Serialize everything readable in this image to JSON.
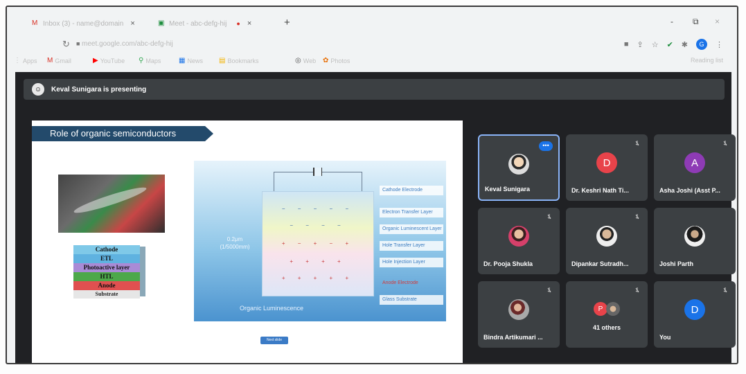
{
  "browser": {
    "tabs": [
      {
        "icon": "gmail-icon",
        "label": "Inbox (3) - name@domain"
      },
      {
        "icon": "meet-icon",
        "label": "Meet - abc-defg-hij"
      }
    ],
    "new_tab": "+",
    "window_controls": [
      "-",
      "⧉",
      "×"
    ],
    "url": "meet.google.com/abc-defg-hij",
    "profile_initial": "G",
    "bookmarks": [
      {
        "icon": "apps-icon",
        "label": "Apps"
      },
      {
        "icon": "gmail-icon",
        "label": "Gmail"
      },
      {
        "icon": "youtube-icon",
        "label": "YouTube"
      },
      {
        "icon": "maps-icon",
        "label": "Maps"
      },
      {
        "icon": "news-icon",
        "label": "News"
      },
      {
        "icon": "folder-icon",
        "label": "Bookmarks"
      },
      {
        "icon": "globe-icon",
        "label": "Web"
      },
      {
        "icon": "photos-icon",
        "label": "Photos"
      }
    ],
    "reading_list": "Reading list"
  },
  "meet": {
    "presenting_banner": "Keval Sunigara is presenting",
    "slide": {
      "title": "Role of organic semiconductors",
      "device_layers": [
        "Cathode",
        "ETL",
        "Photoactive layer",
        "HTL",
        "Anode"
      ],
      "substrate_label": "Substrate",
      "diagram_labels": [
        "Cathode Electrode",
        "Electron Transfer Layer",
        "Organic Luminescent Layer",
        "Hole Transfer Layer",
        "Hole Injection Layer",
        "Anode Electrode",
        "Glass Substrate"
      ],
      "thickness_label": "0.2μm (1/5000mm)",
      "diagram_caption": "Organic Luminescence",
      "bottom_button": "Next slide"
    },
    "participants": [
      {
        "name": "Keval Sunigara",
        "avatar": "photo",
        "active": true
      },
      {
        "name": "Dr. Keshri Nath Ti...",
        "avatar": "initial",
        "initial": "D",
        "color": "#e8434a"
      },
      {
        "name": "Asha Joshi (Asst P...",
        "avatar": "initial",
        "initial": "A",
        "color": "#8e3bb5"
      },
      {
        "name": "Dr. Pooja Shukla",
        "avatar": "photo"
      },
      {
        "name": "Dipankar Sutradh...",
        "avatar": "photo"
      },
      {
        "name": "Joshi Parth",
        "avatar": "photo"
      },
      {
        "name": "Bindra Artikumari ...",
        "avatar": "photo"
      },
      {
        "name": "41 others",
        "avatar": "group"
      },
      {
        "name": "You",
        "avatar": "initial",
        "initial": "D",
        "color": "#1a73e8"
      }
    ],
    "more_options": "•••",
    "colors": {
      "meet_bg": "#202124",
      "tile_bg": "#3c4043",
      "active_border": "#8ab4f8",
      "slide_title_bg": "#234a6b"
    }
  }
}
